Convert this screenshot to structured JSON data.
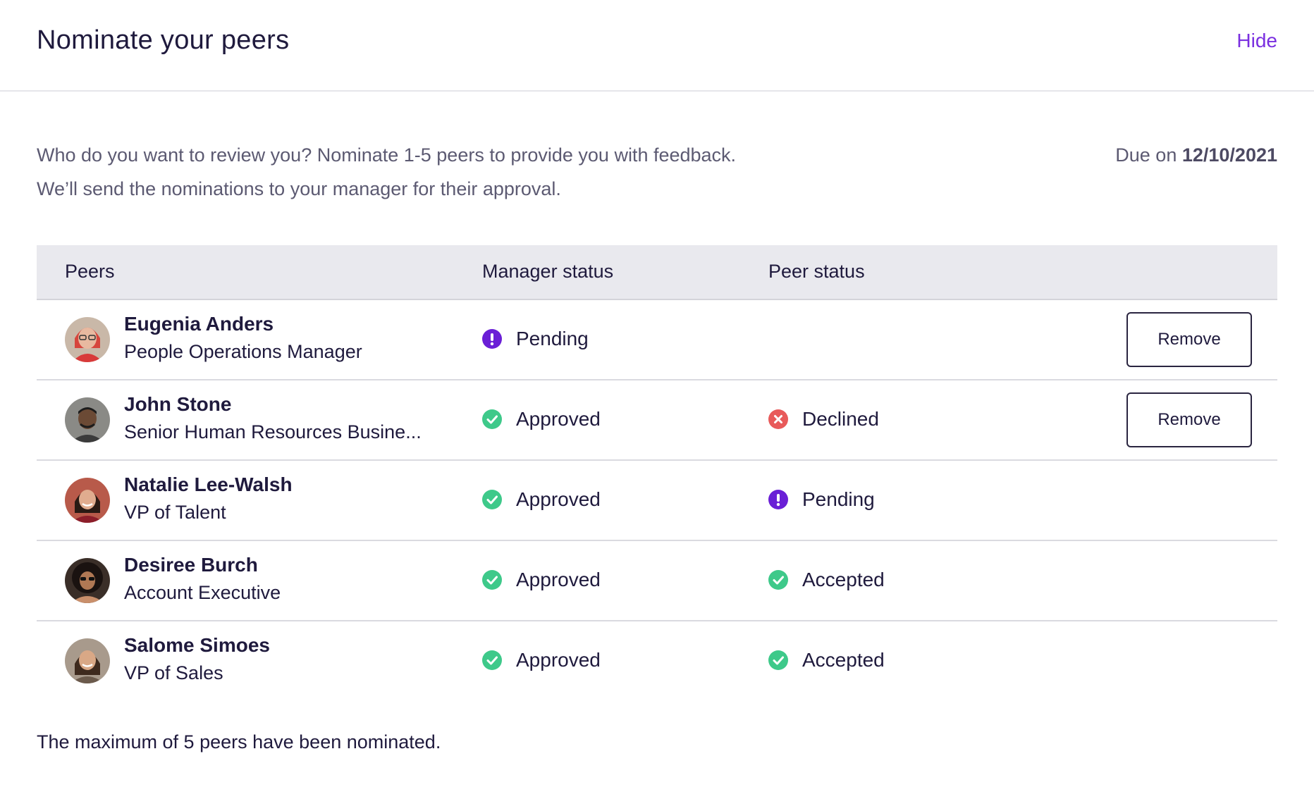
{
  "header": {
    "title": "Nominate your peers",
    "hide_label": "Hide"
  },
  "intro": {
    "line1": "Who do you want to review you? Nominate 1-5 peers to provide you with feedback.",
    "line2": "We’ll send the nominations to your manager for their approval."
  },
  "due": {
    "prefix": "Due on",
    "date": "12/10/2021"
  },
  "table": {
    "columns": {
      "peers": "Peers",
      "manager_status": "Manager status",
      "peer_status": "Peer status"
    },
    "rows": [
      {
        "name": "Eugenia Anders",
        "role": "People Operations Manager",
        "manager_status": "Pending",
        "peer_status": "",
        "remove_label": "Remove"
      },
      {
        "name": "John Stone",
        "role": "Senior Human Resources Busine...",
        "manager_status": "Approved",
        "peer_status": "Declined",
        "remove_label": "Remove"
      },
      {
        "name": "Natalie Lee-Walsh",
        "role": "VP of Talent",
        "manager_status": "Approved",
        "peer_status": "Pending",
        "remove_label": ""
      },
      {
        "name": "Desiree Burch",
        "role": "Account Executive",
        "manager_status": "Approved",
        "peer_status": "Accepted",
        "remove_label": ""
      },
      {
        "name": "Salome Simoes",
        "role": "VP of Sales",
        "manager_status": "Approved",
        "peer_status": "Accepted",
        "remove_label": ""
      }
    ]
  },
  "footer": {
    "note": "The maximum of 5 peers have been nominated."
  },
  "colors": {
    "accent": "#7a2fe0",
    "approved": "#3ec98a",
    "declined": "#e85a5a",
    "pending": "#6a1fd6"
  },
  "icons": {
    "approved": "check-circle-icon",
    "pending": "exclamation-circle-icon",
    "declined": "x-circle-icon"
  }
}
